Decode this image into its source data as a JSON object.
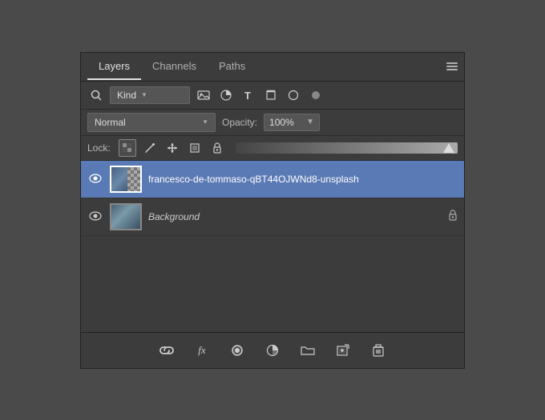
{
  "tabs": [
    {
      "id": "layers",
      "label": "Layers",
      "active": true
    },
    {
      "id": "channels",
      "label": "Channels",
      "active": false
    },
    {
      "id": "paths",
      "label": "Paths",
      "active": false
    }
  ],
  "filter": {
    "kind_label": "Kind",
    "kind_placeholder": "Kind"
  },
  "blend": {
    "mode": "Normal",
    "opacity_label": "Opacity:",
    "opacity_value": "100%"
  },
  "lock": {
    "label": "Lock:"
  },
  "layers": [
    {
      "id": "layer1",
      "name": "francesco-de-tommaso-qBT44OJWNd8-unsplash",
      "visible": true,
      "selected": true,
      "locked": false,
      "type": "image"
    },
    {
      "id": "layer2",
      "name": "Background",
      "visible": true,
      "selected": false,
      "locked": true,
      "type": "background"
    }
  ],
  "bottom_tools": [
    {
      "name": "link-icon",
      "symbol": "⛓"
    },
    {
      "name": "fx-icon",
      "symbol": "fx"
    },
    {
      "name": "fill-layer-icon",
      "symbol": "◉"
    },
    {
      "name": "adjustment-icon",
      "symbol": "◑"
    },
    {
      "name": "folder-icon",
      "symbol": "📁"
    },
    {
      "name": "new-layer-icon",
      "symbol": "⊞"
    },
    {
      "name": "delete-icon",
      "symbol": "🗑"
    }
  ]
}
